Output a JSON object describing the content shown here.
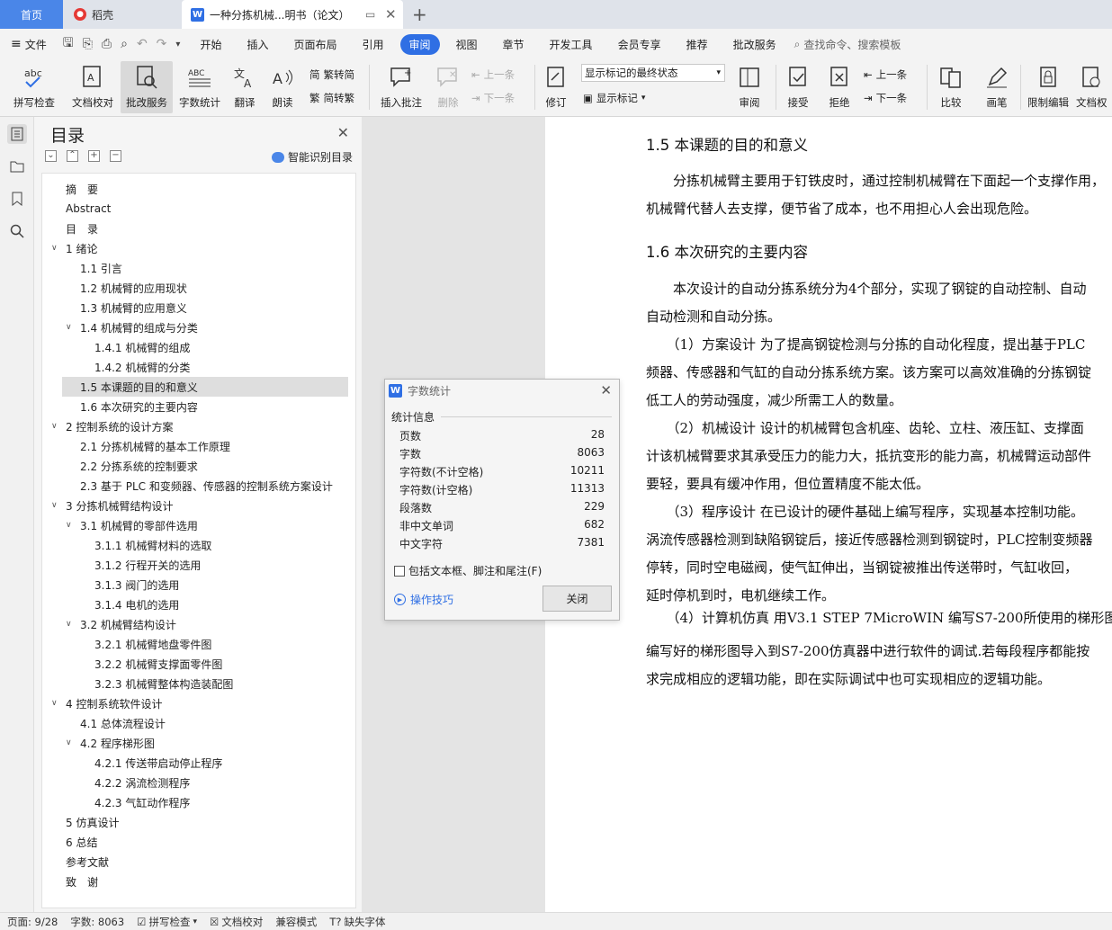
{
  "titlebar": {
    "home_tab": "首页",
    "daoke_tab": "稻壳",
    "doc_tab": "一种分拣机械...明书（论文）"
  },
  "menubar": {
    "file": "文件",
    "items": [
      "开始",
      "插入",
      "页面布局",
      "引用",
      "审阅",
      "视图",
      "章节",
      "开发工具",
      "会员专享",
      "推荐",
      "批改服务"
    ],
    "active": "审阅",
    "search": "查找命令、搜索模板"
  },
  "ribbon": {
    "spell_check": "拼写检查",
    "doc_proof": "文档校对",
    "grading": "批改服务",
    "word_count": "字数统计",
    "translate": "翻译",
    "read_aloud": "朗读",
    "trad_to_simp": "繁转简",
    "simp_to_trad": "简转繁",
    "insert_comment": "插入批注",
    "delete": "删除",
    "prev": "上一条",
    "next": "下一条",
    "revise": "修订",
    "markup_select": "显示标记的最终状态",
    "show_markup": "显示标记",
    "review": "审阅",
    "accept": "接受",
    "reject": "拒绝",
    "prev2": "上一条",
    "next2": "下一条",
    "compare": "比较",
    "pen": "画笔",
    "restrict_edit": "限制编辑",
    "doc_rights": "文档权"
  },
  "toc": {
    "title": "目录",
    "smart": "智能识别目录",
    "items": [
      {
        "label": "摘　要",
        "level": 0,
        "chev": ""
      },
      {
        "label": "Abstract",
        "level": 0,
        "chev": ""
      },
      {
        "label": "目　录",
        "level": 0,
        "chev": ""
      },
      {
        "label": "1  绪论",
        "level": 0,
        "chev": "v"
      },
      {
        "label": "1.1 引言",
        "level": 1,
        "chev": ""
      },
      {
        "label": "1.2  机械臂的应用现状",
        "level": 1,
        "chev": ""
      },
      {
        "label": "1.3  机械臂的应用意义",
        "level": 1,
        "chev": ""
      },
      {
        "label": "1.4 机械臂的组成与分类",
        "level": 1,
        "chev": "v"
      },
      {
        "label": "1.4.1 机械臂的组成",
        "level": 2,
        "chev": ""
      },
      {
        "label": "1.4.2 机械臂的分类",
        "level": 2,
        "chev": ""
      },
      {
        "label": "1.5 本课题的目的和意义",
        "level": 1,
        "chev": "",
        "selected": true
      },
      {
        "label": "1.6  本次研究的主要内容",
        "level": 1,
        "chev": ""
      },
      {
        "label": "2  控制系统的设计方案",
        "level": 0,
        "chev": "v"
      },
      {
        "label": "2.1 分拣机械臂的基本工作原理",
        "level": 1,
        "chev": ""
      },
      {
        "label": "2.2 分拣系统的控制要求",
        "level": 1,
        "chev": ""
      },
      {
        "label": "2.3 基于 PLC 和变频器、传感器的控制系统方案设计",
        "level": 1,
        "chev": ""
      },
      {
        "label": "3  分拣机械臂结构设计",
        "level": 0,
        "chev": "v"
      },
      {
        "label": "3.1 机械臂的零部件选用",
        "level": 1,
        "chev": "v"
      },
      {
        "label": "3.1.1 机械臂材料的选取",
        "level": 2,
        "chev": ""
      },
      {
        "label": "3.1.2 行程开关的选用",
        "level": 2,
        "chev": ""
      },
      {
        "label": "3.1.3  阀门的选用",
        "level": 2,
        "chev": ""
      },
      {
        "label": "3.1.4  电机的选用",
        "level": 2,
        "chev": ""
      },
      {
        "label": "3.2 机械臂结构设计",
        "level": 1,
        "chev": "v"
      },
      {
        "label": "3.2.1 机械臂地盘零件图",
        "level": 2,
        "chev": ""
      },
      {
        "label": "3.2.2 机械臂支撑面零件图",
        "level": 2,
        "chev": ""
      },
      {
        "label": "3.2.3 机械臂整体构造装配图",
        "level": 2,
        "chev": ""
      },
      {
        "label": "4  控制系统软件设计",
        "level": 0,
        "chev": "v"
      },
      {
        "label": "4.1 总体流程设计",
        "level": 1,
        "chev": ""
      },
      {
        "label": "4.2 程序梯形图",
        "level": 1,
        "chev": "v"
      },
      {
        "label": "4.2.1 传送带启动停止程序",
        "level": 2,
        "chev": ""
      },
      {
        "label": "4.2.2 涡流检测程序",
        "level": 2,
        "chev": ""
      },
      {
        "label": "4.2.3 气缸动作程序",
        "level": 2,
        "chev": ""
      },
      {
        "label": "5  仿真设计",
        "level": 0,
        "chev": ""
      },
      {
        "label": "6  总结",
        "level": 0,
        "chev": ""
      },
      {
        "label": "参考文献",
        "level": 0,
        "chev": ""
      },
      {
        "label": "致　谢",
        "level": 0,
        "chev": ""
      }
    ]
  },
  "document": {
    "lines": [
      {
        "text": "1.5 本课题的目的和意义",
        "heading": true
      },
      {
        "text": "　　分拣机械臂主要用于钉铁皮时，通过控制机械臂在下面起一个支撑作用，"
      },
      {
        "text": "机械臂代替人去支撑，便节省了成本，也不用担心人会出现危险。"
      },
      {
        "text": "1.6  本次研究的主要内容",
        "heading": true
      },
      {
        "text": "　　本次设计的自动分拣系统分为4个部分，实现了钢锭的自动控制、自动"
      },
      {
        "text": "自动检测和自动分拣。"
      },
      {
        "text": "　　（1）方案设计  为了提高钢锭检测与分拣的自动化程度，提出基于PLC"
      },
      {
        "text": "频器、传感器和气缸的自动分拣系统方案。该方案可以高效准确的分拣钢锭"
      },
      {
        "text": "低工人的劳动强度，减少所需工人的数量。"
      },
      {
        "text": "　　（2）机械设计  设计的机械臂包含机座、齿轮、立柱、液压缸、支撑面"
      },
      {
        "text": "计该机械臂要求其承受压力的能力大，抵抗变形的能力高，机械臂运动部件"
      },
      {
        "text": "要轻，要具有缓冲作用，但位置精度不能太低。"
      },
      {
        "text": "　　（3）程序设计  在已设计的硬件基础上编写程序，实现基本控制功能。"
      },
      {
        "text": "涡流传感器检测到缺陷钢锭后，接近传感器检测到钢锭时，PLC控制变频器"
      },
      {
        "text": "停转，同时空电磁阀，使气缸伸出，当钢锭被推出传送带时，气缸收回，"
      },
      {
        "text": "延时停机到时，电机继续工作。"
      },
      {
        "text": "　　（4）计算机仿真  用V3.1 STEP 7MicroWIN  编写S7-200所使用的梯形图"
      },
      {
        "text": "编写好的梯形图导入到S7-200仿真器中进行软件的调试.若每段程序都能按"
      },
      {
        "text": "求完成相应的逻辑功能，即在实际调试中也可实现相应的逻辑功能。"
      }
    ]
  },
  "word_count_dialog": {
    "title": "字数统计",
    "group_label": "统计信息",
    "rows": [
      {
        "label": "页数",
        "value": "28"
      },
      {
        "label": "字数",
        "value": "8063"
      },
      {
        "label": "字符数(不计空格)",
        "value": "10211"
      },
      {
        "label": "字符数(计空格)",
        "value": "11313"
      },
      {
        "label": "段落数",
        "value": "229"
      },
      {
        "label": "非中文单词",
        "value": "682"
      },
      {
        "label": "中文字符",
        "value": "7381"
      }
    ],
    "checkbox_label": "包括文本框、脚注和尾注(F)",
    "tips": "操作技巧",
    "close_button": "关闭"
  },
  "statusbar": {
    "page": "页面: 9/28",
    "words": "字数: 8063",
    "spell": "拼写检查",
    "proof": "文档校对",
    "compat": "兼容模式",
    "missing_font": "缺失字体"
  }
}
